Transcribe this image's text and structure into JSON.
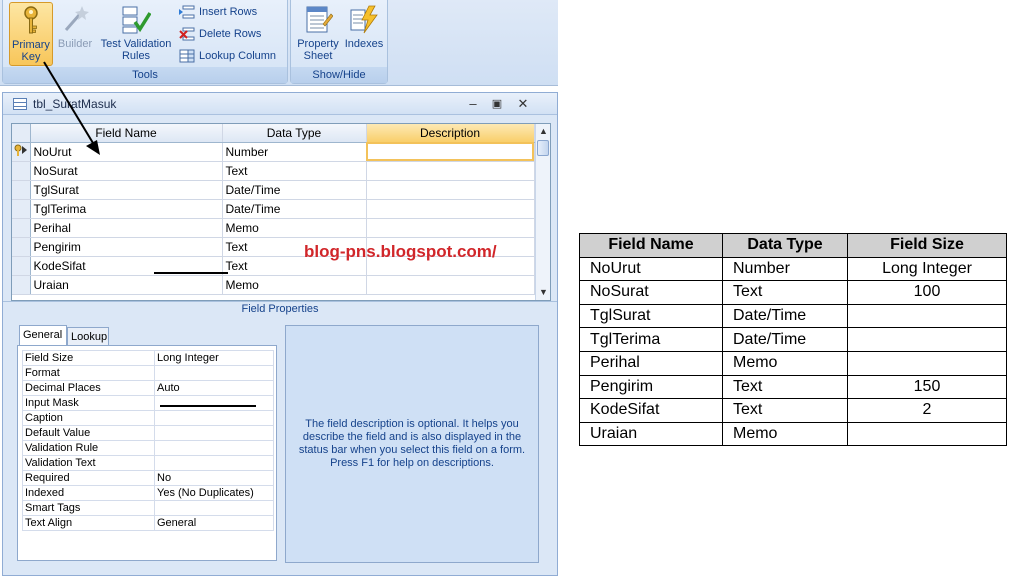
{
  "ribbon": {
    "tools_group_label": "Tools",
    "show_hide_group_label": "Show/Hide",
    "primary_key": "Primary Key",
    "builder": "Builder",
    "test_validation": "Test Validation Rules",
    "insert_rows": "Insert Rows",
    "delete_rows": "Delete Rows",
    "lookup_column": "Lookup Column",
    "property_sheet": "Property Sheet",
    "indexes": "Indexes"
  },
  "window": {
    "title": "tbl_SuratMasuk",
    "columns": [
      "Field Name",
      "Data Type",
      "Description"
    ],
    "rows": [
      {
        "field": "NoUrut",
        "type": "Number"
      },
      {
        "field": "NoSurat",
        "type": "Text"
      },
      {
        "field": "TglSurat",
        "type": "Date/Time"
      },
      {
        "field": "TglTerima",
        "type": "Date/Time"
      },
      {
        "field": "Perihal",
        "type": "Memo"
      },
      {
        "field": "Pengirim",
        "type": "Text"
      },
      {
        "field": "KodeSifat",
        "type": "Text"
      },
      {
        "field": "Uraian",
        "type": "Memo"
      }
    ],
    "field_properties_label": "Field Properties",
    "tabs": [
      "General",
      "Lookup"
    ],
    "properties": [
      {
        "k": "Field Size",
        "v": "Long Integer"
      },
      {
        "k": "Format",
        "v": ""
      },
      {
        "k": "Decimal Places",
        "v": "Auto"
      },
      {
        "k": "Input Mask",
        "v": ""
      },
      {
        "k": "Caption",
        "v": ""
      },
      {
        "k": "Default Value",
        "v": ""
      },
      {
        "k": "Validation Rule",
        "v": ""
      },
      {
        "k": "Validation Text",
        "v": ""
      },
      {
        "k": "Required",
        "v": "No"
      },
      {
        "k": "Indexed",
        "v": "Yes (No Duplicates)"
      },
      {
        "k": "Smart Tags",
        "v": ""
      },
      {
        "k": "Text Align",
        "v": "General"
      }
    ],
    "help_text": "The field description is optional.  It helps you describe the field and is also displayed in the status bar when you select this field on a form.  Press F1 for help on descriptions."
  },
  "watermark": "blog-pns.blogspot.com/",
  "summary_table": {
    "headers": [
      "Field Name",
      "Data Type",
      "Field Size"
    ],
    "rows": [
      [
        "NoUrut",
        "Number",
        "Long Integer"
      ],
      [
        "NoSurat",
        "Text",
        "100"
      ],
      [
        "TglSurat",
        "Date/Time",
        ""
      ],
      [
        "TglTerima",
        "Date/Time",
        ""
      ],
      [
        "Perihal",
        "Memo",
        ""
      ],
      [
        "Pengirim",
        "Text",
        "150"
      ],
      [
        "KodeSifat",
        "Text",
        "2"
      ],
      [
        "Uraian",
        "Memo",
        ""
      ]
    ]
  },
  "colors": {
    "watermark": "#d1262a",
    "accent": "#15428b",
    "primary_key_highlight": "#f8c65a"
  }
}
